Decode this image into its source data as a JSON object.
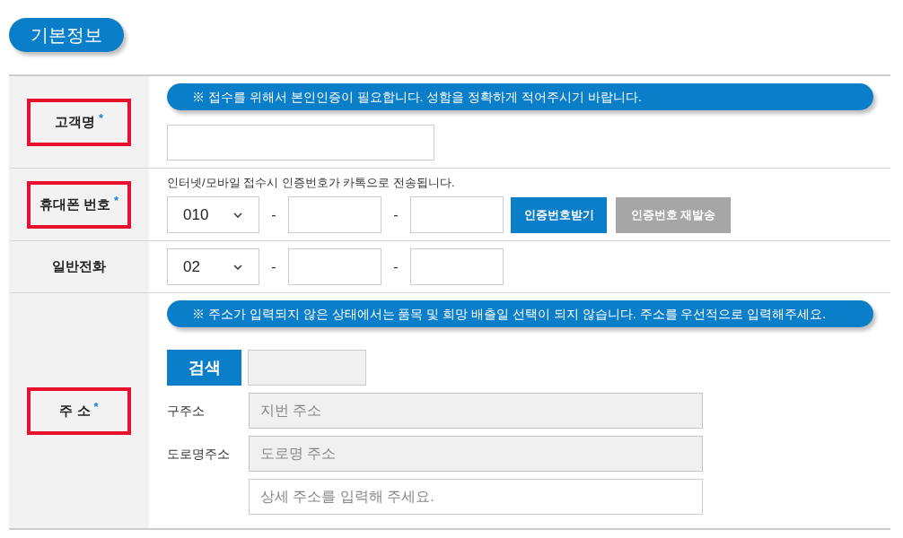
{
  "section_title": "기본정보",
  "rows": [
    {
      "kind": "name",
      "label": "고객명",
      "required_mark": "*",
      "highlighted": true,
      "notice": "※ 접수를 위해서 본인인증이 필요합니다. 성함을 정확하게 적어주시기 바랍니다."
    },
    {
      "kind": "phone",
      "label": "휴대폰 번호",
      "required_mark": "*",
      "highlighted": true,
      "hint": "인터넷/모바일 접수시 인증번호가 카톡으로 전송됩니다.",
      "prefix": "010",
      "separators": [
        "-",
        "-"
      ],
      "buttons": [
        {
          "label": "인증번호받기",
          "disabled": false
        },
        {
          "label": "인증번호 재발송",
          "disabled": true
        }
      ]
    },
    {
      "kind": "phone",
      "label": "일반전화",
      "highlighted": false,
      "prefix": "02",
      "separators": [
        "-",
        "-"
      ]
    },
    {
      "kind": "address",
      "label": "주 소",
      "required_mark": "*",
      "highlighted": true,
      "notice": "※ 주소가 입력되지 않은 상태에서는 품목 및 희망 배출일 선택이 되지 않습니다. 주소를 우선적으로 입력해주세요.",
      "search_button": "검색",
      "address_fields": [
        {
          "caption": "구주소",
          "placeholder": "지번 주소",
          "readonly": true
        },
        {
          "caption": "도로명주소",
          "placeholder": "도로명 주소",
          "readonly": true
        },
        {
          "placeholder": "상세 주소를 입력해 주세요.",
          "readonly": false
        }
      ]
    }
  ]
}
